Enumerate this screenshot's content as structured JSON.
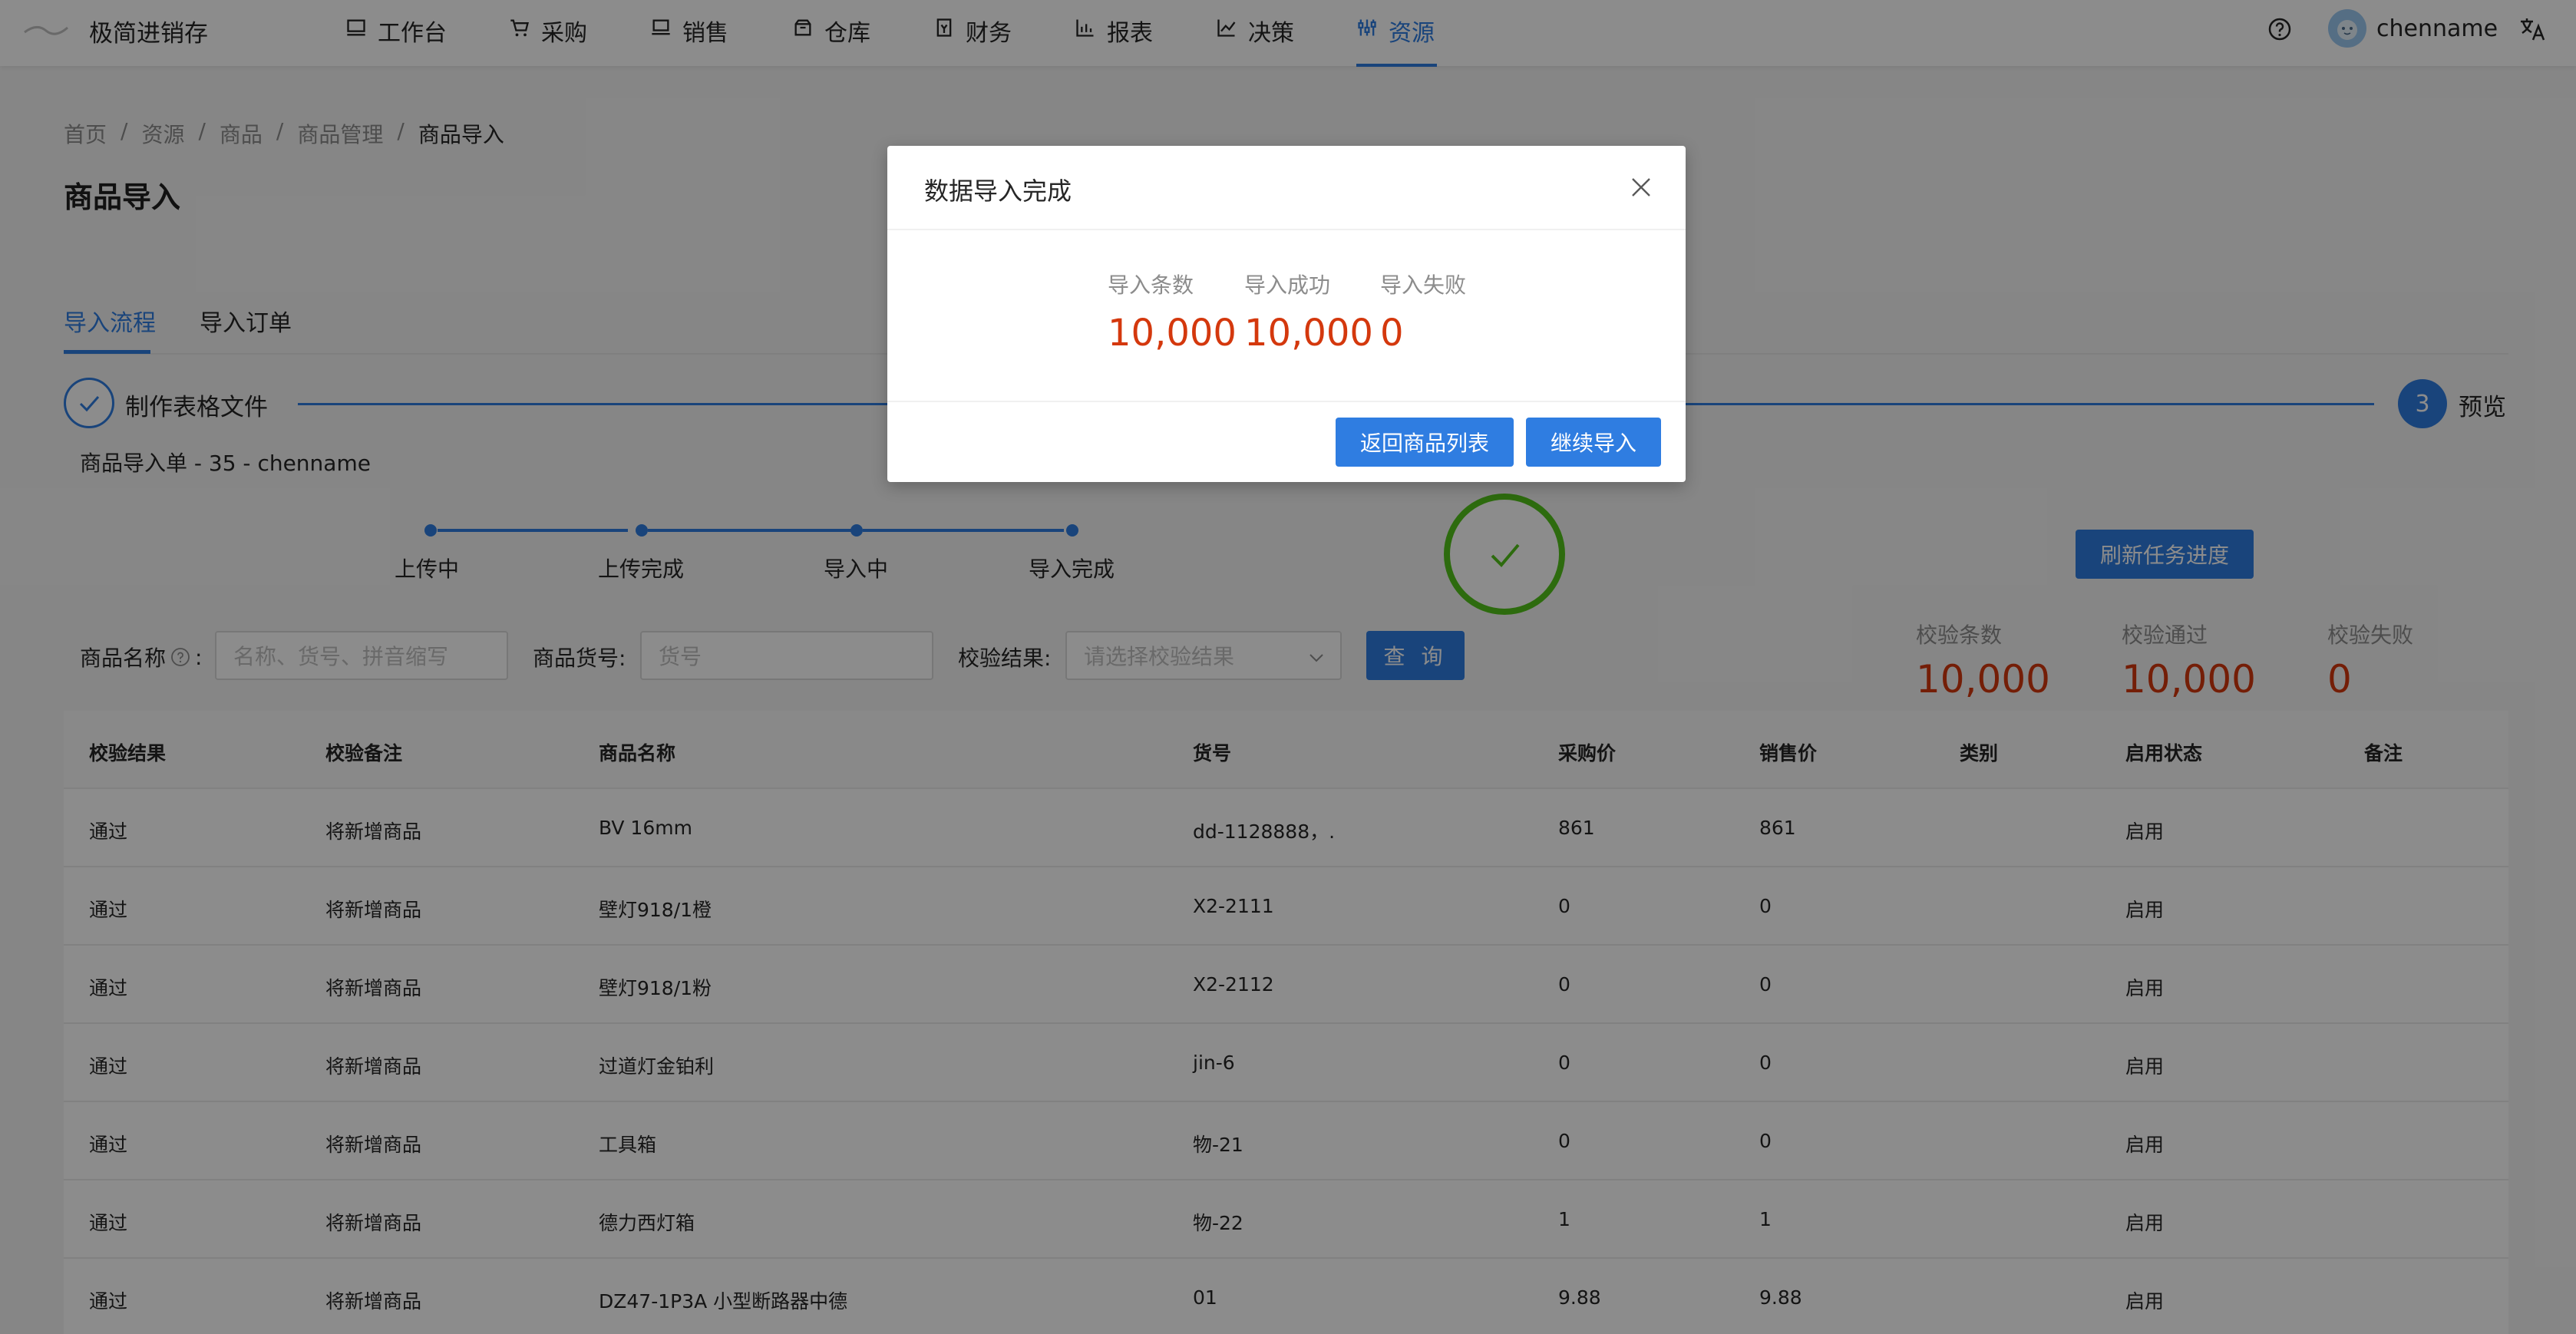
{
  "app": {
    "name": "极简进销存",
    "username": "chenname"
  },
  "nav": [
    {
      "label": "工作台",
      "icon": "monitor-icon"
    },
    {
      "label": "采购",
      "icon": "cart-icon"
    },
    {
      "label": "销售",
      "icon": "laptop-icon"
    },
    {
      "label": "仓库",
      "icon": "box-icon"
    },
    {
      "label": "财务",
      "icon": "ledger-icon"
    },
    {
      "label": "报表",
      "icon": "bar-chart-icon"
    },
    {
      "label": "决策",
      "icon": "line-chart-icon"
    },
    {
      "label": "资源",
      "icon": "sliders-icon",
      "active": true
    }
  ],
  "breadcrumb": [
    "首页",
    "资源",
    "商品",
    "商品管理",
    "商品导入"
  ],
  "page_title": "商品导入",
  "tabs": [
    {
      "label": "导入流程",
      "active": true
    },
    {
      "label": "导入订单"
    }
  ],
  "steps": {
    "step1": "制作表格文件",
    "step3_number": "3",
    "step3": "预览"
  },
  "order_title": "商品导入单 - 35 - chenname",
  "progress": [
    "上传中",
    "上传完成",
    "导入中",
    "导入完成"
  ],
  "refresh_label": "刷新任务进度",
  "filters": {
    "name_label": "商品名称",
    "name_colon": ":",
    "name_placeholder": "名称、货号、拼音缩写",
    "code_label": "商品货号:",
    "code_placeholder": "货号",
    "result_label": "校验结果:",
    "result_placeholder": "请选择校验结果",
    "query_label": "查 询"
  },
  "validation_stats": [
    {
      "label": "校验条数",
      "value": "10,000"
    },
    {
      "label": "校验通过",
      "value": "10,000"
    },
    {
      "label": "校验失败",
      "value": "0"
    }
  ],
  "table": {
    "headers": [
      "校验结果",
      "校验备注",
      "商品名称",
      "货号",
      "采购价",
      "销售价",
      "类别",
      "启用状态",
      "备注"
    ],
    "rows": [
      [
        "通过",
        "将新增商品",
        "BV 16mm",
        "dd-1128888，.",
        "861",
        "861",
        "",
        "启用",
        ""
      ],
      [
        "通过",
        "将新增商品",
        "壁灯918/1橙",
        "X2-2111",
        "0",
        "0",
        "",
        "启用",
        ""
      ],
      [
        "通过",
        "将新增商品",
        "壁灯918/1粉",
        "X2-2112",
        "0",
        "0",
        "",
        "启用",
        ""
      ],
      [
        "通过",
        "将新增商品",
        "过道灯金铂利",
        "jin-6",
        "0",
        "0",
        "",
        "启用",
        ""
      ],
      [
        "通过",
        "将新增商品",
        "工具箱",
        "物-21",
        "0",
        "0",
        "",
        "启用",
        ""
      ],
      [
        "通过",
        "将新增商品",
        "德力西灯箱",
        "物-22",
        "1",
        "1",
        "",
        "启用",
        ""
      ],
      [
        "通过",
        "将新增商品",
        "DZ47-1P3A 小型断路器中德",
        "01",
        "9.88",
        "9.88",
        "",
        "启用",
        ""
      ]
    ]
  },
  "modal": {
    "title": "数据导入完成",
    "stats": [
      {
        "label": "导入条数",
        "value": "10,000"
      },
      {
        "label": "导入成功",
        "value": "10,000"
      },
      {
        "label": "导入失败",
        "value": "0"
      }
    ],
    "back_label": "返回商品列表",
    "continue_label": "继续导入"
  },
  "colors": {
    "primary": "#2f7de1",
    "danger_value": "#d4380d",
    "success": "#52c41a"
  }
}
